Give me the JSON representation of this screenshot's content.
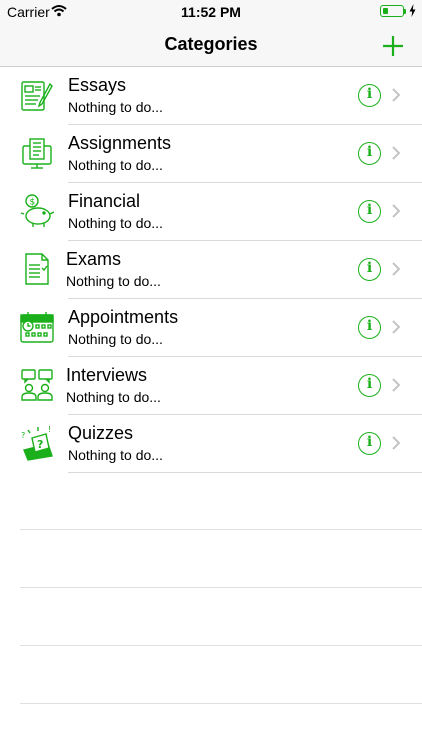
{
  "status_bar": {
    "carrier": "Carrier",
    "time": "11:52 PM",
    "battery_level": 0.3
  },
  "nav": {
    "title": "Categories",
    "add_icon": "plus-icon"
  },
  "colors": {
    "accent": "#1bb01b",
    "separator": "#d9d9d9",
    "bar_bg": "#f7f7f7"
  },
  "categories": [
    {
      "title": "Essays",
      "subtitle": "Nothing to do...",
      "icon": "essay-document-icon"
    },
    {
      "title": "Assignments",
      "subtitle": "Nothing to do...",
      "icon": "assignment-computer-icon"
    },
    {
      "title": "Financial",
      "subtitle": "Nothing to do...",
      "icon": "piggy-bank-icon"
    },
    {
      "title": "Exams",
      "subtitle": "Nothing to do...",
      "icon": "exam-paper-icon"
    },
    {
      "title": "Appointments",
      "subtitle": "Nothing to do...",
      "icon": "calendar-icon"
    },
    {
      "title": "Interviews",
      "subtitle": "Nothing to do...",
      "icon": "interview-people-icon"
    },
    {
      "title": "Quizzes",
      "subtitle": "Nothing to do...",
      "icon": "quiz-question-icon"
    }
  ]
}
